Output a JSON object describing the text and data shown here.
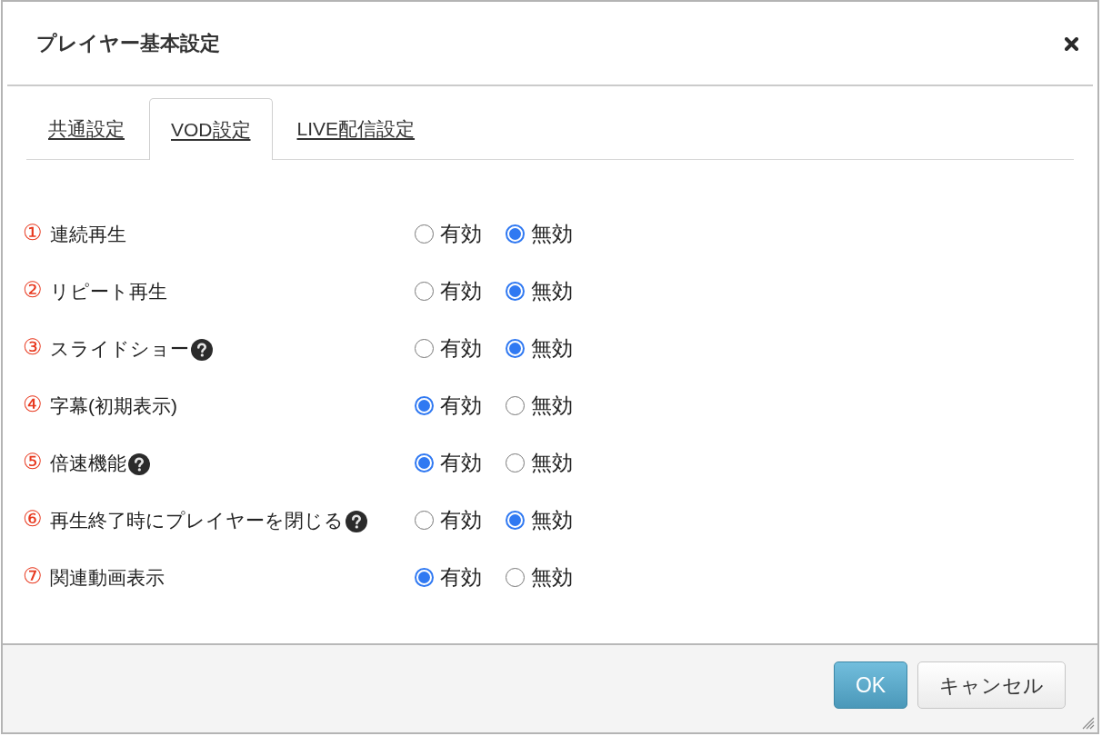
{
  "dialog": {
    "title": "プレイヤー基本設定"
  },
  "tabs": [
    {
      "label": "共通設定",
      "selected": false
    },
    {
      "label": "VOD設定",
      "selected": true
    },
    {
      "label": "LIVE配信設定",
      "selected": false
    }
  ],
  "settings": [
    {
      "number": "①",
      "label": "連続再生",
      "help": false,
      "options": [
        {
          "label": "有効",
          "selected": false
        },
        {
          "label": "無効",
          "selected": true
        }
      ]
    },
    {
      "number": "②",
      "label": "リピート再生",
      "help": false,
      "options": [
        {
          "label": "有効",
          "selected": false
        },
        {
          "label": "無効",
          "selected": true
        }
      ]
    },
    {
      "number": "③",
      "label": "スライドショー",
      "help": true,
      "options": [
        {
          "label": "有効",
          "selected": false
        },
        {
          "label": "無効",
          "selected": true
        }
      ]
    },
    {
      "number": "④",
      "label": "字幕(初期表示)",
      "help": false,
      "options": [
        {
          "label": "有効",
          "selected": true
        },
        {
          "label": "無効",
          "selected": false
        }
      ]
    },
    {
      "number": "⑤",
      "label": "倍速機能",
      "help": true,
      "options": [
        {
          "label": "有効",
          "selected": true
        },
        {
          "label": "無効",
          "selected": false
        }
      ]
    },
    {
      "number": "⑥",
      "label": "再生終了時にプレイヤーを閉じる",
      "help": true,
      "options": [
        {
          "label": "有効",
          "selected": false
        },
        {
          "label": "無効",
          "selected": true
        }
      ]
    },
    {
      "number": "⑦",
      "label": "関連動画表示",
      "help": false,
      "options": [
        {
          "label": "有効",
          "selected": true
        },
        {
          "label": "無効",
          "selected": false
        }
      ]
    }
  ],
  "buttons": [
    {
      "label": "OK",
      "kind": "primary"
    },
    {
      "label": "キャンセル",
      "kind": "secondary"
    }
  ]
}
